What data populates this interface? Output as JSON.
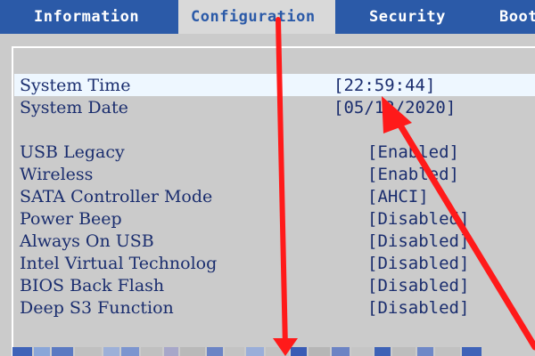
{
  "tabs": [
    {
      "label": "Information"
    },
    {
      "label": "Configuration"
    },
    {
      "label": "Security"
    },
    {
      "label": "Boot"
    }
  ],
  "settings": [
    {
      "label": "System Time",
      "value": "[22:59:44]"
    },
    {
      "label": "System Date",
      "value": "[05/12/2020]"
    },
    {
      "label": "USB Legacy",
      "value": "[Enabled]"
    },
    {
      "label": "Wireless",
      "value": "[Enabled]"
    },
    {
      "label": "SATA Controller Mode",
      "value": "[AHCI]"
    },
    {
      "label": "Power Beep",
      "value": "[Disabled]"
    },
    {
      "label": "Always On USB",
      "value": "[Disabled]"
    },
    {
      "label": "Intel Virtual Technolog",
      "value": "[Disabled]"
    },
    {
      "label": "BIOS Back Flash",
      "value": "[Disabled]"
    },
    {
      "label": "Deep S3 Function",
      "value": "[Disabled]"
    }
  ],
  "colors": {
    "tab_bar": "#2b5aa8",
    "active_tab_bg": "#d9d9d9",
    "panel_bg": "#cbcbcb",
    "text": "#1a2d6e",
    "highlight": "#eef7ff",
    "annotation_arrow": "#ff1a1a"
  }
}
